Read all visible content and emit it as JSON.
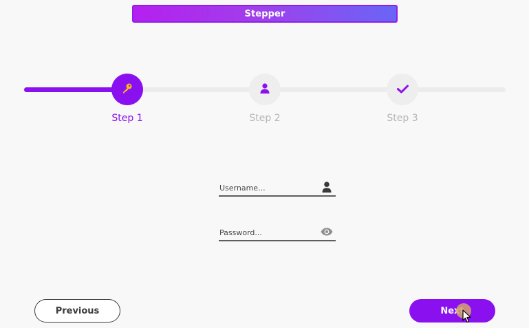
{
  "header": {
    "title": "Stepper"
  },
  "stepper": {
    "progress": 0.2,
    "active_index": 0,
    "steps": [
      {
        "label": "Step 1",
        "icon": "key-icon",
        "state": "active"
      },
      {
        "label": "Step 2",
        "icon": "user-icon",
        "state": "inactive"
      },
      {
        "label": "Step 3",
        "icon": "check-icon",
        "state": "inactive"
      }
    ]
  },
  "form": {
    "username": {
      "value": "",
      "placeholder": "Username...",
      "icon": "user-icon"
    },
    "password": {
      "value": "",
      "placeholder": "Password...",
      "icon": "eye-icon"
    }
  },
  "buttons": {
    "previous_label": "Previous",
    "next_label": "Next"
  },
  "colors": {
    "accent": "#8a10f0",
    "key_icon": "#f5b91a",
    "inactive_track": "#ececec",
    "inactive_label": "#b5b5b5"
  }
}
